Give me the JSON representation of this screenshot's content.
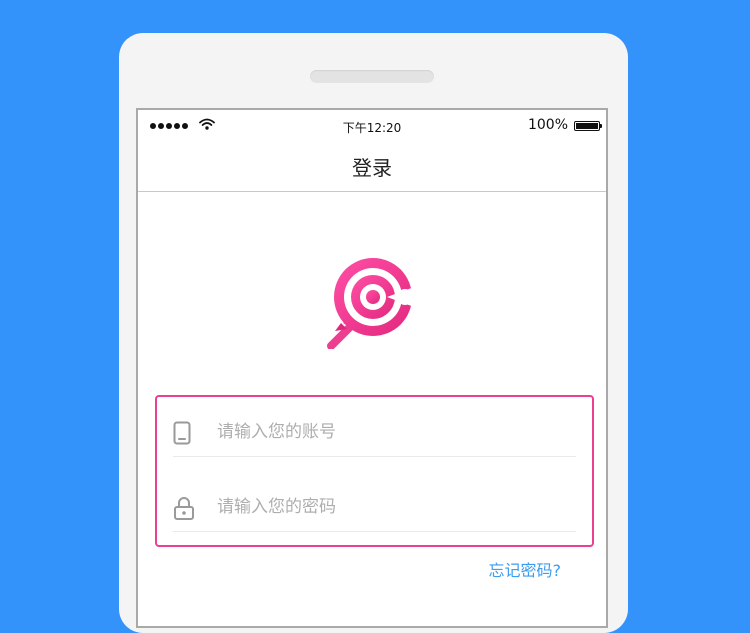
{
  "status_bar": {
    "time": "下午12:20",
    "battery": "100%"
  },
  "nav": {
    "title": "登录"
  },
  "logo": {
    "icon": "lollipop-logo-icon",
    "color": "#EE3E92"
  },
  "login_form": {
    "account": {
      "icon": "phone-icon",
      "placeholder": "请输入您的账号",
      "value": ""
    },
    "password": {
      "icon": "lock-icon",
      "placeholder": "请输入您的密码",
      "value": ""
    },
    "forgot_password": "忘记密码?"
  },
  "colors": {
    "background": "#3393FB",
    "accent": "#EE3E92",
    "link": "#3C9DF0"
  }
}
